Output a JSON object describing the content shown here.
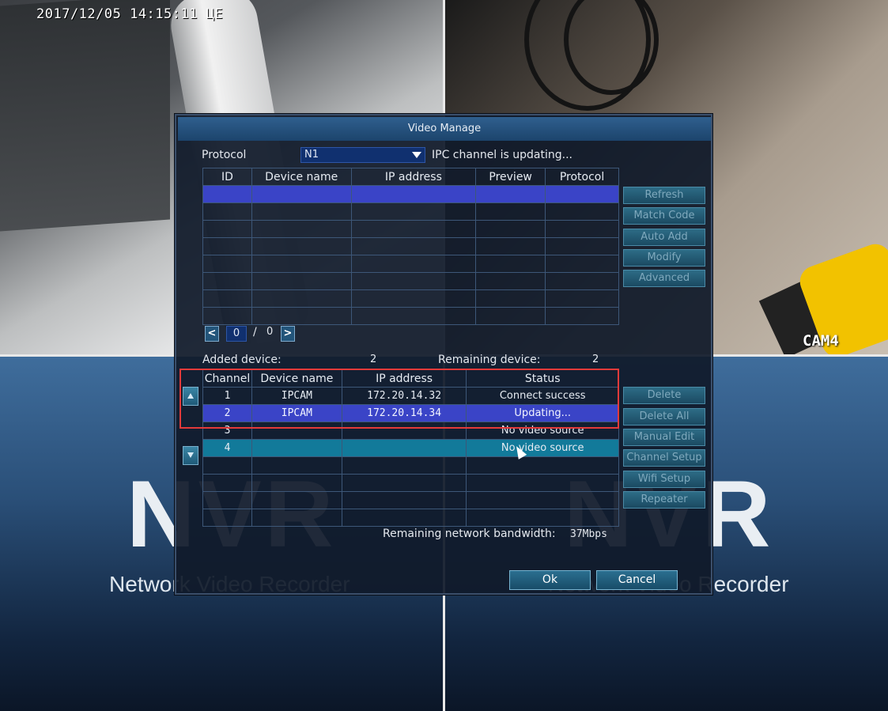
{
  "overlay": {
    "timestamp": "2017/12/05 14:15:11 ЦЕ",
    "cam_label": "CAM4",
    "nvr_logo_left": "NVR",
    "nvr_logo_right": "NVR",
    "nvr_tagline_left": "Network Video Recorder",
    "nvr_tagline_right": "Network Video Recorder"
  },
  "dialog": {
    "title": "Video Manage",
    "protocol_label": "Protocol",
    "protocol_value": "N1",
    "protocol_status": "IPC channel is updating...",
    "search_table": {
      "headers": [
        "ID",
        "Device name",
        "IP address",
        "Preview",
        "Protocol"
      ]
    },
    "pager": {
      "prev_label": "<",
      "next_label": ">",
      "current": "0",
      "separator": "/",
      "total": "0"
    },
    "side_buttons_top": [
      "Refresh",
      "Match Code",
      "Auto Add",
      "Modify",
      "Advanced"
    ],
    "added_device_label": "Added device:",
    "added_device_value": "2",
    "remaining_device_label": "Remaining device:",
    "remaining_device_value": "2",
    "added_table": {
      "headers": [
        "Channel",
        "Device name",
        "IP address",
        "Status"
      ],
      "rows": [
        {
          "channel": "1",
          "device": "IPCAM",
          "ip": "172.20.14.32",
          "status": "Connect success"
        },
        {
          "channel": "2",
          "device": "IPCAM",
          "ip": "172.20.14.34",
          "status": "Updating..."
        },
        {
          "channel": "3",
          "device": "",
          "ip": "",
          "status": "No video source"
        },
        {
          "channel": "4",
          "device": "",
          "ip": "",
          "status": "No video source"
        }
      ]
    },
    "side_buttons_bottom": [
      "Delete",
      "Delete All",
      "Manual Edit",
      "Channel Setup",
      "Wifi Setup",
      "Repeater"
    ],
    "bandwidth_label": "Remaining network bandwidth:",
    "bandwidth_value": "37Mbps",
    "ok_label": "Ok",
    "cancel_label": "Cancel"
  },
  "colors": {
    "selected_row": "#3a44c7",
    "hover_row": "#127a9a",
    "highlight_box": "#e23a3a",
    "title_bar": "#2f5f8e"
  },
  "icons": [
    "dropdown-arrow-icon",
    "scroll-up-icon",
    "scroll-down-icon",
    "mouse-cursor-icon"
  ]
}
